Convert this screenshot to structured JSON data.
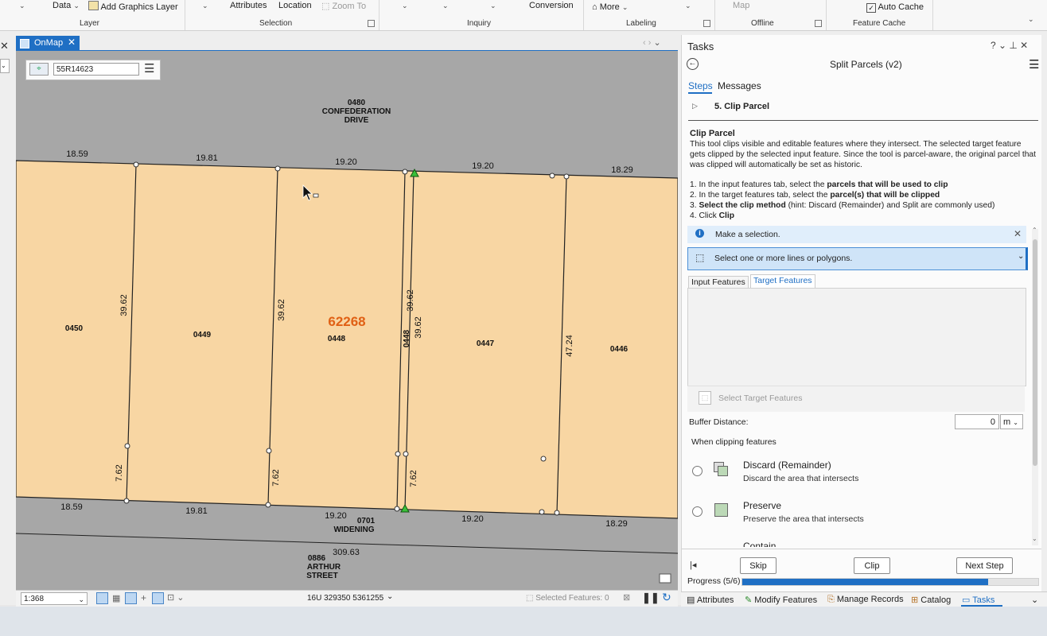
{
  "ribbon": {
    "data_label": "Data",
    "add_graphics_layer": "Add Graphics Layer",
    "attributes": "Attributes",
    "location": "Location",
    "zoom_to": "Zoom To",
    "conversion": "Conversion",
    "more": "More",
    "map": "Map",
    "auto_cache": "Auto Cache",
    "groups": {
      "layer": "Layer",
      "selection": "Selection",
      "inquiry": "Inquiry",
      "labeling": "Labeling",
      "offline": "Offline",
      "feature_cache": "Feature Cache"
    }
  },
  "map_view": {
    "tab_title": "OnMap",
    "locate_value": "55R14623",
    "parcel_number": "62268",
    "parcel_number_color": "#e06014",
    "parcel_fill": "#f8d6a3",
    "road_fill": "#a7a7a7",
    "road_top_labels": [
      "0480",
      "CONFEDERATION",
      "DRIVE"
    ],
    "road_widening_labels": [
      "0701",
      "WIDENING"
    ],
    "road_bottom_labels": [
      "0886",
      "ARTHUR",
      "STREET"
    ],
    "lots": [
      "0450",
      "0449",
      "0448",
      "0448",
      "0447",
      "0446"
    ],
    "top_dims": [
      "18.59",
      "19.81",
      "19.20",
      "19.20",
      "18.29"
    ],
    "bottom_dims": [
      "18.59",
      "19.81",
      "19.20",
      "19.20",
      "18.29"
    ],
    "side_dims": [
      "39.62",
      "39.62",
      "39.62",
      "39.62",
      "47.24"
    ],
    "short_dims": [
      "7.62",
      "7.62",
      "7.62"
    ],
    "road_dim": "309.63"
  },
  "status_bar": {
    "scale": "1:368",
    "coordinates": "16U 329350 5361255",
    "selected_features": "Selected Features: 0"
  },
  "tasks": {
    "pane_title": "Tasks",
    "task_name": "Split Parcels (v2)",
    "tab_steps": "Steps",
    "tab_messages": "Messages",
    "current_step": "5.  Clip Parcel",
    "section_title": "Clip Parcel",
    "description": "This tool clips visible and editable features where they intersect. The selected target feature gets clipped by the selected input feature. Since the tool is parcel-aware, the original parcel that was clipped will automatically be set as historic.",
    "instr1_a": "1. In the input features tab, select the ",
    "instr1_b": "parcels that will be used to clip",
    "instr2_a": "2. In the target features tab, select the ",
    "instr2_b": "parcel(s) that will be clipped",
    "instr3_a": "3. ",
    "instr3_b": "Select the clip method",
    "instr3_c": " (hint: Discard (Remainder) and Split are commonly used)",
    "instr4_a": "4. Click ",
    "instr4_b": "Clip",
    "info_message": "Make a selection.",
    "select_tool": "Select one or more lines or polygons.",
    "input_features_tab": "Input Features",
    "target_features_tab": "Target Features",
    "select_target_features": "Select Target Features",
    "buffer_label": "Buffer Distance:",
    "buffer_value": "0",
    "buffer_unit": "m",
    "clipping_label": "When clipping features",
    "option1_title": "Discard (Remainder)",
    "option1_desc": "Discard the area that intersects",
    "option2_title": "Preserve",
    "option2_desc": "Preserve the area that intersects",
    "option3_title": "Contain",
    "skip": "Skip",
    "clip": "Clip",
    "next_step": "Next Step",
    "progress_label": "Progress (5/6)",
    "progress_fraction": 0.83
  },
  "bottom_tabs": [
    "Attributes",
    "Modify Features",
    "Manage Records",
    "Catalog",
    "Tasks"
  ]
}
